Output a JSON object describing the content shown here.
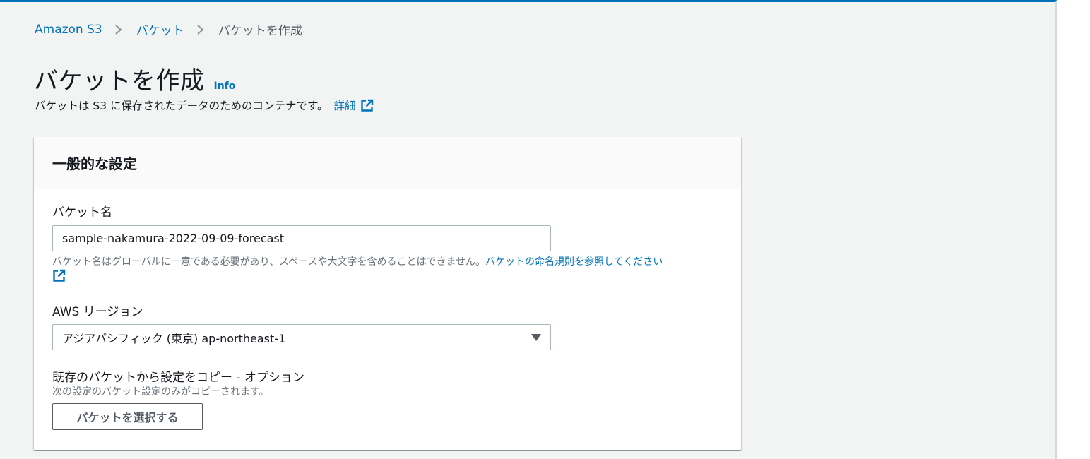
{
  "breadcrumb": {
    "items": [
      "Amazon S3",
      "バケット"
    ],
    "current": "バケットを作成"
  },
  "page": {
    "title": "バケットを作成",
    "info_label": "Info",
    "subtitle": "バケットは S3 に保存されたデータのためのコンテナです。",
    "detail_link": "詳細"
  },
  "card": {
    "title": "一般的な設定",
    "bucket_name": {
      "label": "バケット名",
      "value": "sample-nakamura-2022-09-09-forecast",
      "hint": "バケット名はグローバルに一意である必要があり、スペースや大文字を含めることはできません。",
      "rule_link": "バケットの命名規則を参照してください"
    },
    "region": {
      "label": "AWS リージョン",
      "selected": "アジアパシフィック (東京) ap-northeast-1"
    },
    "copy_settings": {
      "label": "既存のバケットから設定をコピー - オプション",
      "description": "次の設定のバケット設定のみがコピーされます。",
      "button_label": "バケットを選択する"
    }
  },
  "colors": {
    "accent": "#0073bb",
    "page_background": "#f2f3f3",
    "text": "#16191f",
    "muted_text": "#687078"
  },
  "icons": [
    "chevron-right-icon",
    "external-link-icon",
    "caret-down-icon"
  ]
}
